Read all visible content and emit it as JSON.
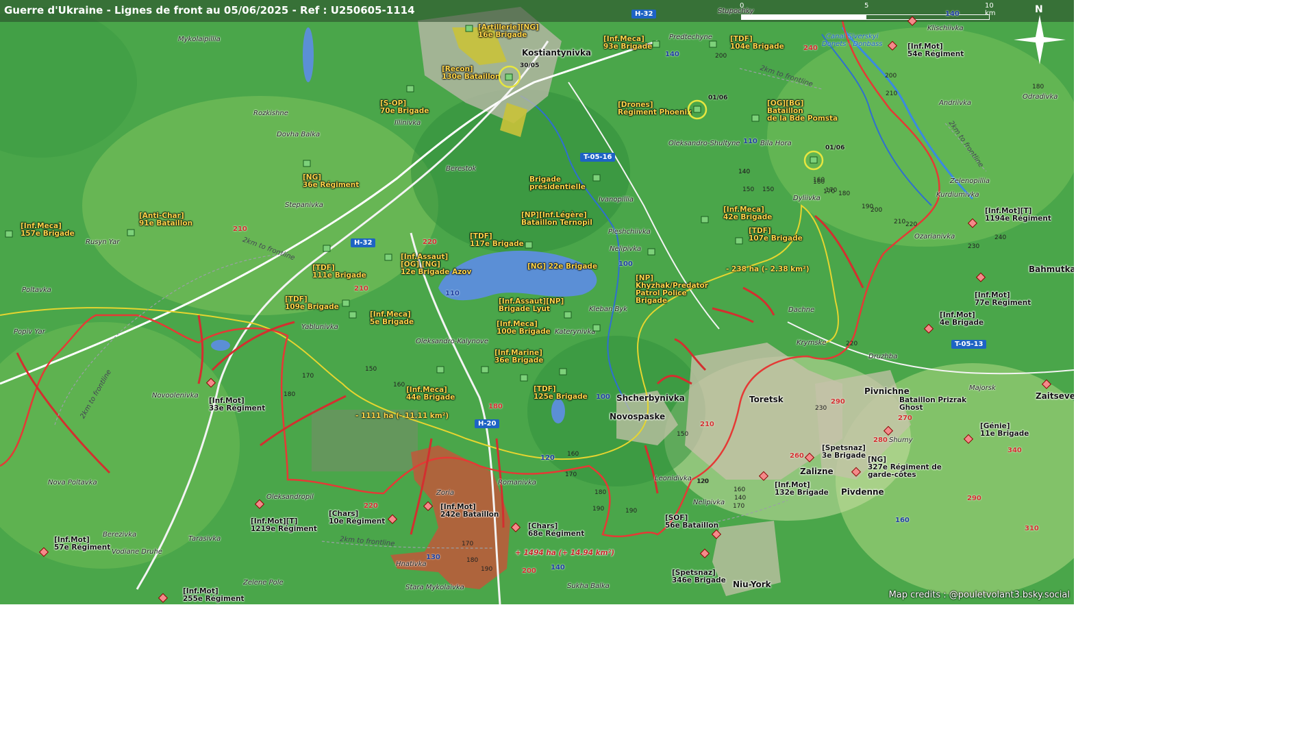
{
  "title": "Guerre d'Ukraine - Lignes de front au 05/06/2025 - Ref : U250605-1114",
  "credits": "Map credits : @pouletvolant3.bsky.social",
  "scale": {
    "l0": "0",
    "l5": "5",
    "l10": "10 km"
  },
  "north": "N",
  "colors": {
    "ua": "#ffd54a",
    "ru": "#d32f2f",
    "road": "#1e63c4",
    "terrain": "#43a047"
  },
  "towns_major": [
    "Kostiantynivka",
    "Shcherbynivka",
    "Novospaske",
    "Toretsk",
    "Pivnichne",
    "Zalizne",
    "Pivdenne",
    "Niu-York",
    "Bahmutka",
    "Zaitseve"
  ],
  "towns": [
    "Mykolaipillia",
    "Rozkishne",
    "Illinivka",
    "Dovha Balka",
    "Berestok",
    "Stepanivka",
    "Rusyn Yar",
    "Poltavka",
    "Popiv Yar",
    "Yablunivka",
    "Oleksandro-Kalynove",
    "Novoolenivka",
    "Nova Poltavka",
    "Oleksandropil",
    "Berezivka",
    "Tarasivka",
    "Vodiane Druhe",
    "Zelene Pole",
    "Hnativka",
    "Stara Mykolaivka",
    "Zoria",
    "Romanivka",
    "Sukha Balka",
    "Predtechyne",
    "Stupochky",
    "Oleksandro-Shultyne",
    "Bila Hora",
    "Ivanopillia",
    "Pleshchiivka",
    "Nelipivka",
    "Kleban Byk",
    "Katerynivka",
    "Dyliivka",
    "Dachne",
    "Krymske",
    "Druzhba",
    "Leonidivka",
    "Nelipivka",
    "Shumy",
    "Majorsk",
    "Klischiivka",
    "Andriivka",
    "Odradivka",
    "Zelenopillia",
    "Kurdiumivka",
    "Ozarianivka"
  ],
  "roads": [
    "H-32",
    "H-32",
    "T-05-16",
    "H-20",
    "T-05-13"
  ],
  "ua_units": [
    "[Artillerie][NG]\n16e Brigade",
    "[Recon]\n130e Bataillon",
    "[S-OP]\n70e Brigade",
    "[NG]\n36e Régiment",
    "[Anti-Char]\n91e Bataillon",
    "[Inf.Meca]\n157e Brigade",
    "[TDF]\n111e Brigade",
    "[TDF]\n109e Brigade",
    "[Inf.Meca]\n5e Brigade",
    "[Inf.Assaut]\n[OG] [NG]\n12e Brigade Azov",
    "[TDF]\n117e Brigade",
    "[NG] 22e Brigade",
    "[Inf.Meca]\n93e Brigade",
    "[TDF]\n104e Brigade",
    "[Drones]\nRégiment Phoenix",
    "[OG][BG]\nBataillon\nde la Bde Pomsta",
    "Brigade\nprésidentielle",
    "[NP][Inf.Légère]\nBataillon Ternopil",
    "[Inf.Meca]\n42e Brigade",
    "[TDF]\n107e Brigade",
    "[NP]\nKhyzhak/Predator\nPatrol Police\nBrigade",
    "[Inf.Assaut][NP]\nBrigade Lyut",
    "[Inf.Meca]\n100e Brigade",
    "[Inf.Marine]\n36e Brigade",
    "[TDF]\n125e Brigade",
    "[Inf.Meca]\n44e Brigade"
  ],
  "ru_units": [
    "[Inf.Mot]\n54e Régiment",
    "[Inf.Mot][T]\n1194e Régiment",
    "[Inf.Mot]\n77e Régiment",
    "[Inf.Mot]\n4e Brigade",
    "Bataillon Prizrak\nGhost",
    "[Génie]\n11e Brigade",
    "[Spetsnaz]\n3e Brigade",
    "[NG]\n327e Régiment de\ngarde-côtes",
    "[Inf.Mot]\n132e Brigade",
    "[SOF]\n56e Bataillon",
    "[Spetsnaz]\n346e Brigade",
    "[Chars]\n68e Régiment",
    "[Inf.Mot]\n242e Bataillon",
    "[Chars]\n10e Régiment",
    "[Inf.Mot][T]\n1219e Régiment",
    "[Inf.Mot]\n33e Régiment",
    "[Inf.Mot]\n57e Régiment",
    "[Inf.Mot]\n255e Régiment"
  ],
  "areas": {
    "ua_loss_1": "- 1111 ha (- 11.11 km²)",
    "ua_loss_2": "- 238 ha (- 2.38 km²)",
    "ru_gain": "+ 1494 ha (+ 14.94 km²)"
  },
  "dates": [
    "30/05",
    "01/06",
    "01/06"
  ],
  "frontline_labels": [
    "2km to frontline",
    "2km to frontline",
    "2km to frontline",
    "2km to frontline",
    "2km to frontline"
  ],
  "canal": "Canal Siverskyi\nDonets - Donbass",
  "heights_black": [
    "200",
    "210",
    "220",
    "140",
    "150",
    "160",
    "170",
    "180",
    "190",
    "200",
    "210",
    "220",
    "230",
    "240",
    "150",
    "160",
    "170",
    "180",
    "190",
    "120",
    "160",
    "170",
    "180",
    "190",
    "140",
    "170",
    "180",
    "190",
    "150",
    "170",
    "160",
    "230",
    "150",
    "120",
    "160",
    "140",
    "180",
    "200",
    "170"
  ],
  "heights_red": [
    "210",
    "220",
    "210",
    "180",
    "220",
    "200",
    "290",
    "270",
    "280",
    "260",
    "340",
    "310",
    "290",
    "240",
    "210"
  ],
  "heights_blue": [
    "140",
    "110",
    "110",
    "100",
    "120",
    "130",
    "140",
    "160",
    "140",
    "100"
  ]
}
